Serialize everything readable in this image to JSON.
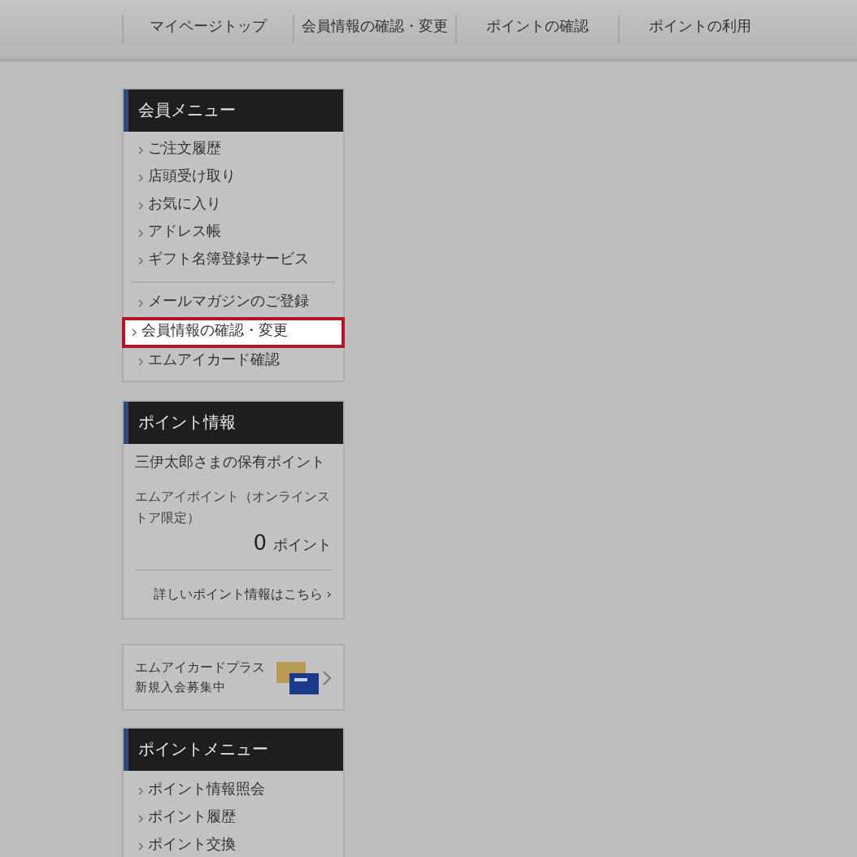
{
  "nav": [
    {
      "label": "マイページトップ"
    },
    {
      "label": "会員情報の確認・変更"
    },
    {
      "label": "ポイントの確認"
    },
    {
      "label": "ポイントの利用"
    }
  ],
  "member_menu": {
    "title": "会員メニュー",
    "groups": [
      [
        {
          "label": "ご注文履歴",
          "selected": false
        },
        {
          "label": "店頭受け取り",
          "selected": false
        },
        {
          "label": "お気に入り",
          "selected": false
        },
        {
          "label": "アドレス帳",
          "selected": false
        },
        {
          "label": "ギフト名簿登録サービス",
          "selected": false
        }
      ],
      [
        {
          "label": "メールマガジンのご登録",
          "selected": false
        },
        {
          "label": "会員情報の確認・変更",
          "selected": true
        },
        {
          "label": "エムアイカード確認",
          "selected": false
        }
      ]
    ]
  },
  "point_info": {
    "title": "ポイント情報",
    "owner": "三伊太郎さまの保有ポイント",
    "point_label": "エムアイポイント（オンラインストア限定）",
    "points": "0",
    "unit": "ポイント",
    "link": "詳しいポイント情報はこちら ›"
  },
  "card_banner": {
    "line_1": "エムアイカードプラス",
    "line_2": "新規入会募集中"
  },
  "point_menu": {
    "title": "ポイントメニュー",
    "items": [
      {
        "label": "ポイント情報照会",
        "selected": false
      },
      {
        "label": "ポイント履歴",
        "selected": false
      },
      {
        "label": "ポイント交換",
        "selected": false
      }
    ]
  }
}
